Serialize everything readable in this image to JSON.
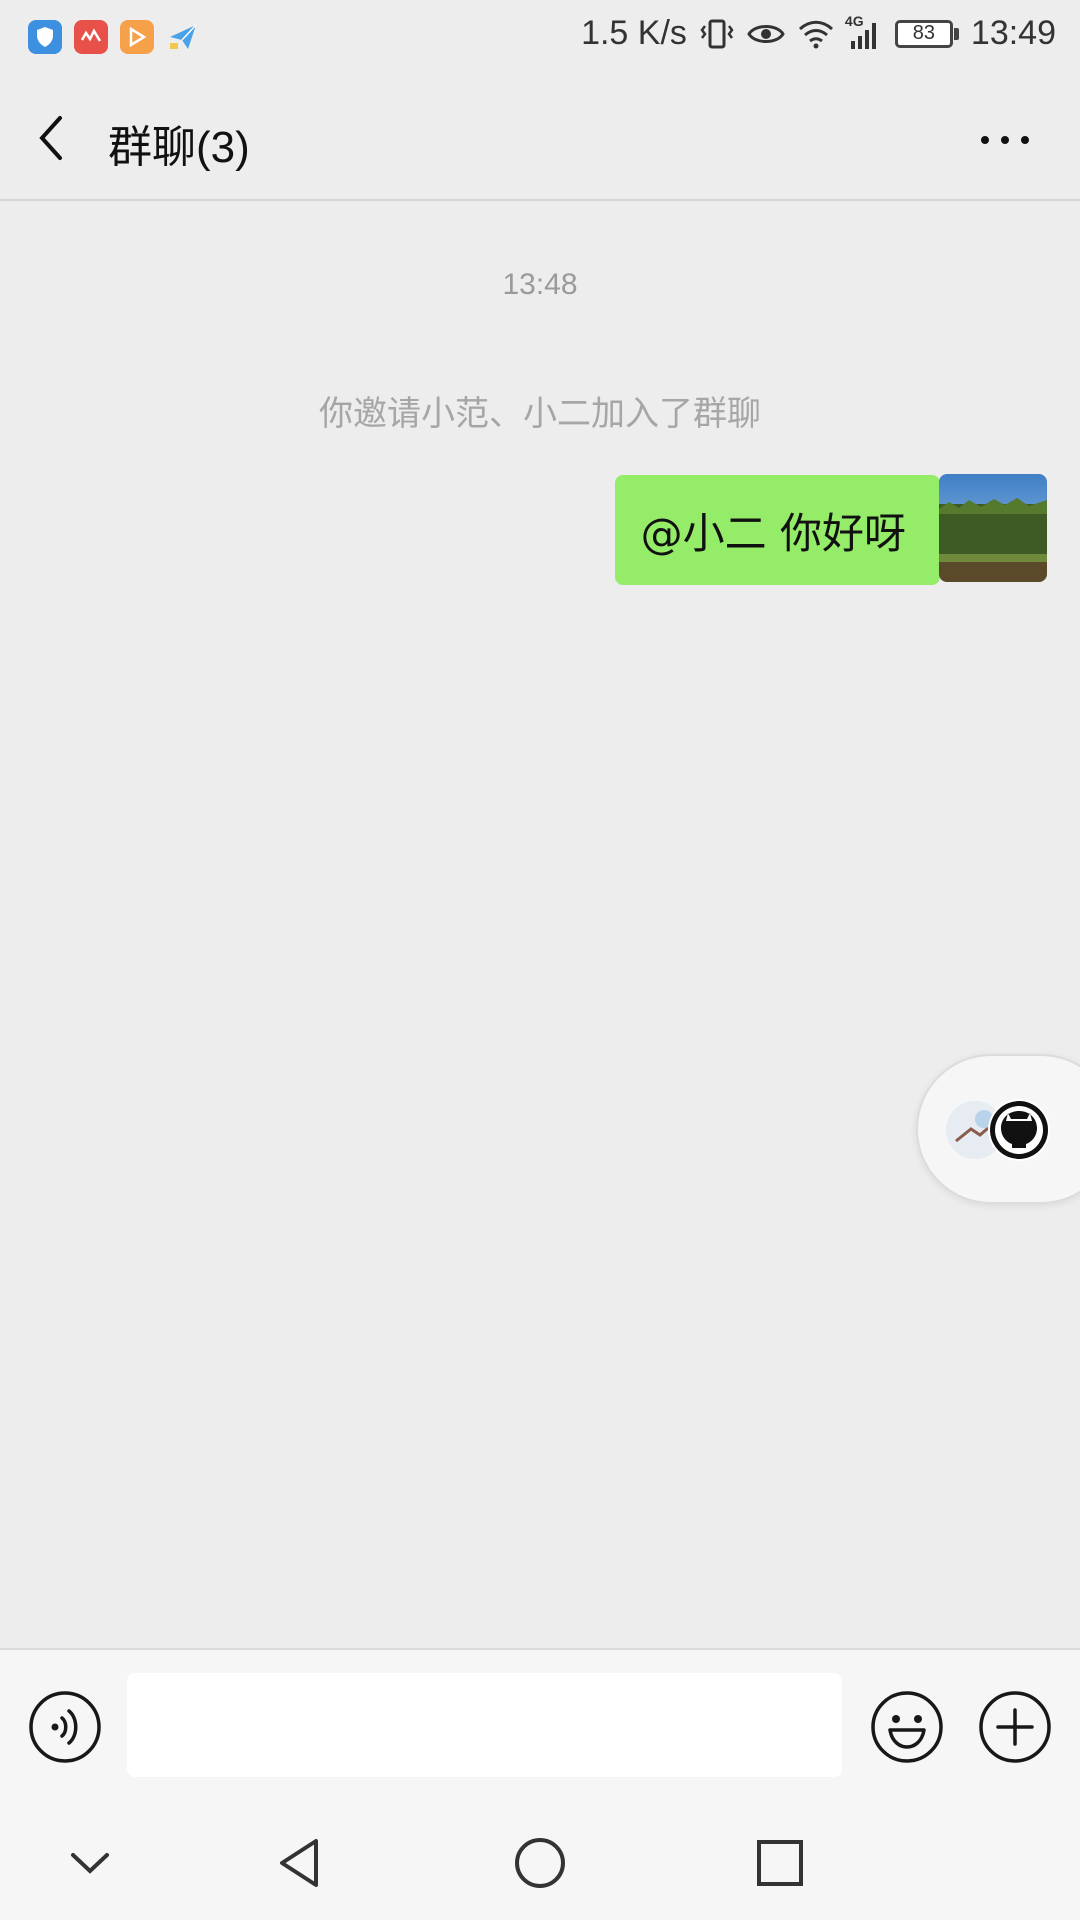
{
  "status_bar": {
    "network_speed": "1.5 K/s",
    "network_type": "4G",
    "battery": "83",
    "time": "13:49",
    "app_icons": [
      "shield-app-icon",
      "music-app-icon",
      "video-app-icon",
      "send-app-icon"
    ]
  },
  "header": {
    "title": "群聊(3)"
  },
  "chat": {
    "timestamp": "13:48",
    "system_message": "你邀请小范、小二加入了群聊",
    "messages": [
      {
        "sender": "me",
        "text": "@小二  你好呀"
      }
    ]
  },
  "input": {
    "value": "",
    "placeholder": ""
  },
  "colors": {
    "background": "#ededed",
    "bubble_self": "#95ec69",
    "bar": "#f6f6f6"
  }
}
